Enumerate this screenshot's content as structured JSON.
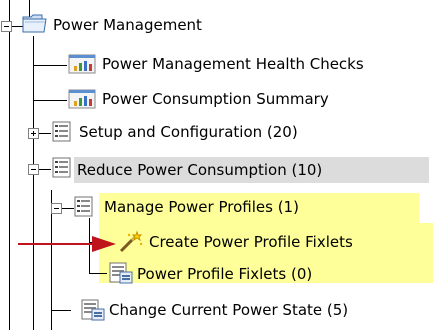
{
  "tree": {
    "root": {
      "label": "Power Management",
      "icon": "folder-icon"
    },
    "items": [
      {
        "label": "Power Management Health Checks",
        "icon": "dashboard-icon"
      },
      {
        "label": "Power Consumption Summary",
        "icon": "dashboard-icon"
      },
      {
        "label": "Setup and Configuration (20)",
        "icon": "list-icon"
      },
      {
        "label": "Reduce Power Consumption (10)",
        "icon": "list-icon"
      },
      {
        "label": "Manage Power Profiles (1)",
        "icon": "list-icon"
      },
      {
        "label": "Create Power Profile Fixlets",
        "icon": "wizard-wand-icon"
      },
      {
        "label": "Power Profile Fixlets (0)",
        "icon": "fixlet-list-icon"
      },
      {
        "label": "Change Current Power State (5)",
        "icon": "fixlet-list-icon"
      }
    ]
  },
  "colors": {
    "selection_gray": "#dcdcdc",
    "highlight_yellow": "#ffff99",
    "arrow_red": "#c0141c"
  }
}
